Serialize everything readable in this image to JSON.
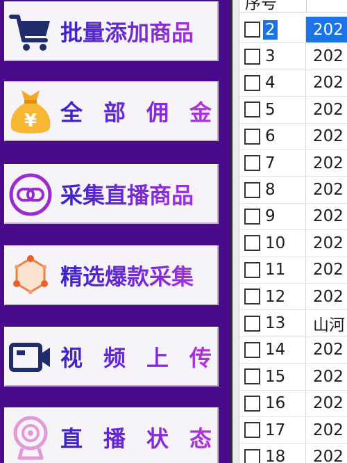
{
  "sidebar": {
    "items": [
      {
        "label": "批量添加商品",
        "icon": "shopping-cart-icon"
      },
      {
        "label": "全部佣金",
        "icon": "money-bag-icon"
      },
      {
        "label": "采集直播商品",
        "icon": "link-circle-icon"
      },
      {
        "label": "精选爆款采集",
        "icon": "hexagon-nodes-icon"
      },
      {
        "label": "视频上传",
        "icon": "video-camera-icon"
      },
      {
        "label": "直播状态",
        "icon": "webcam-icon"
      }
    ]
  },
  "table": {
    "header": {
      "col1": "序号"
    },
    "rows": [
      {
        "no": "2",
        "date": "202",
        "selected": true
      },
      {
        "no": "3",
        "date": "202"
      },
      {
        "no": "4",
        "date": "202"
      },
      {
        "no": "5",
        "date": "202"
      },
      {
        "no": "6",
        "date": "202"
      },
      {
        "no": "7",
        "date": "202"
      },
      {
        "no": "8",
        "date": "202"
      },
      {
        "no": "9",
        "date": "202"
      },
      {
        "no": "10",
        "date": "202"
      },
      {
        "no": "11",
        "date": "202"
      },
      {
        "no": "12",
        "date": "202"
      },
      {
        "no": "13",
        "date": "山河"
      },
      {
        "no": "14",
        "date": "202"
      },
      {
        "no": "15",
        "date": "202"
      },
      {
        "no": "16",
        "date": "202"
      },
      {
        "no": "17",
        "date": "202"
      },
      {
        "no": "18",
        "date": "202"
      }
    ]
  },
  "colors": {
    "sidebar_bg": "#4a0a8c",
    "selection": "#1a73e8",
    "label_gradient_start": "#3a23c8",
    "label_gradient_end": "#b830e0"
  }
}
